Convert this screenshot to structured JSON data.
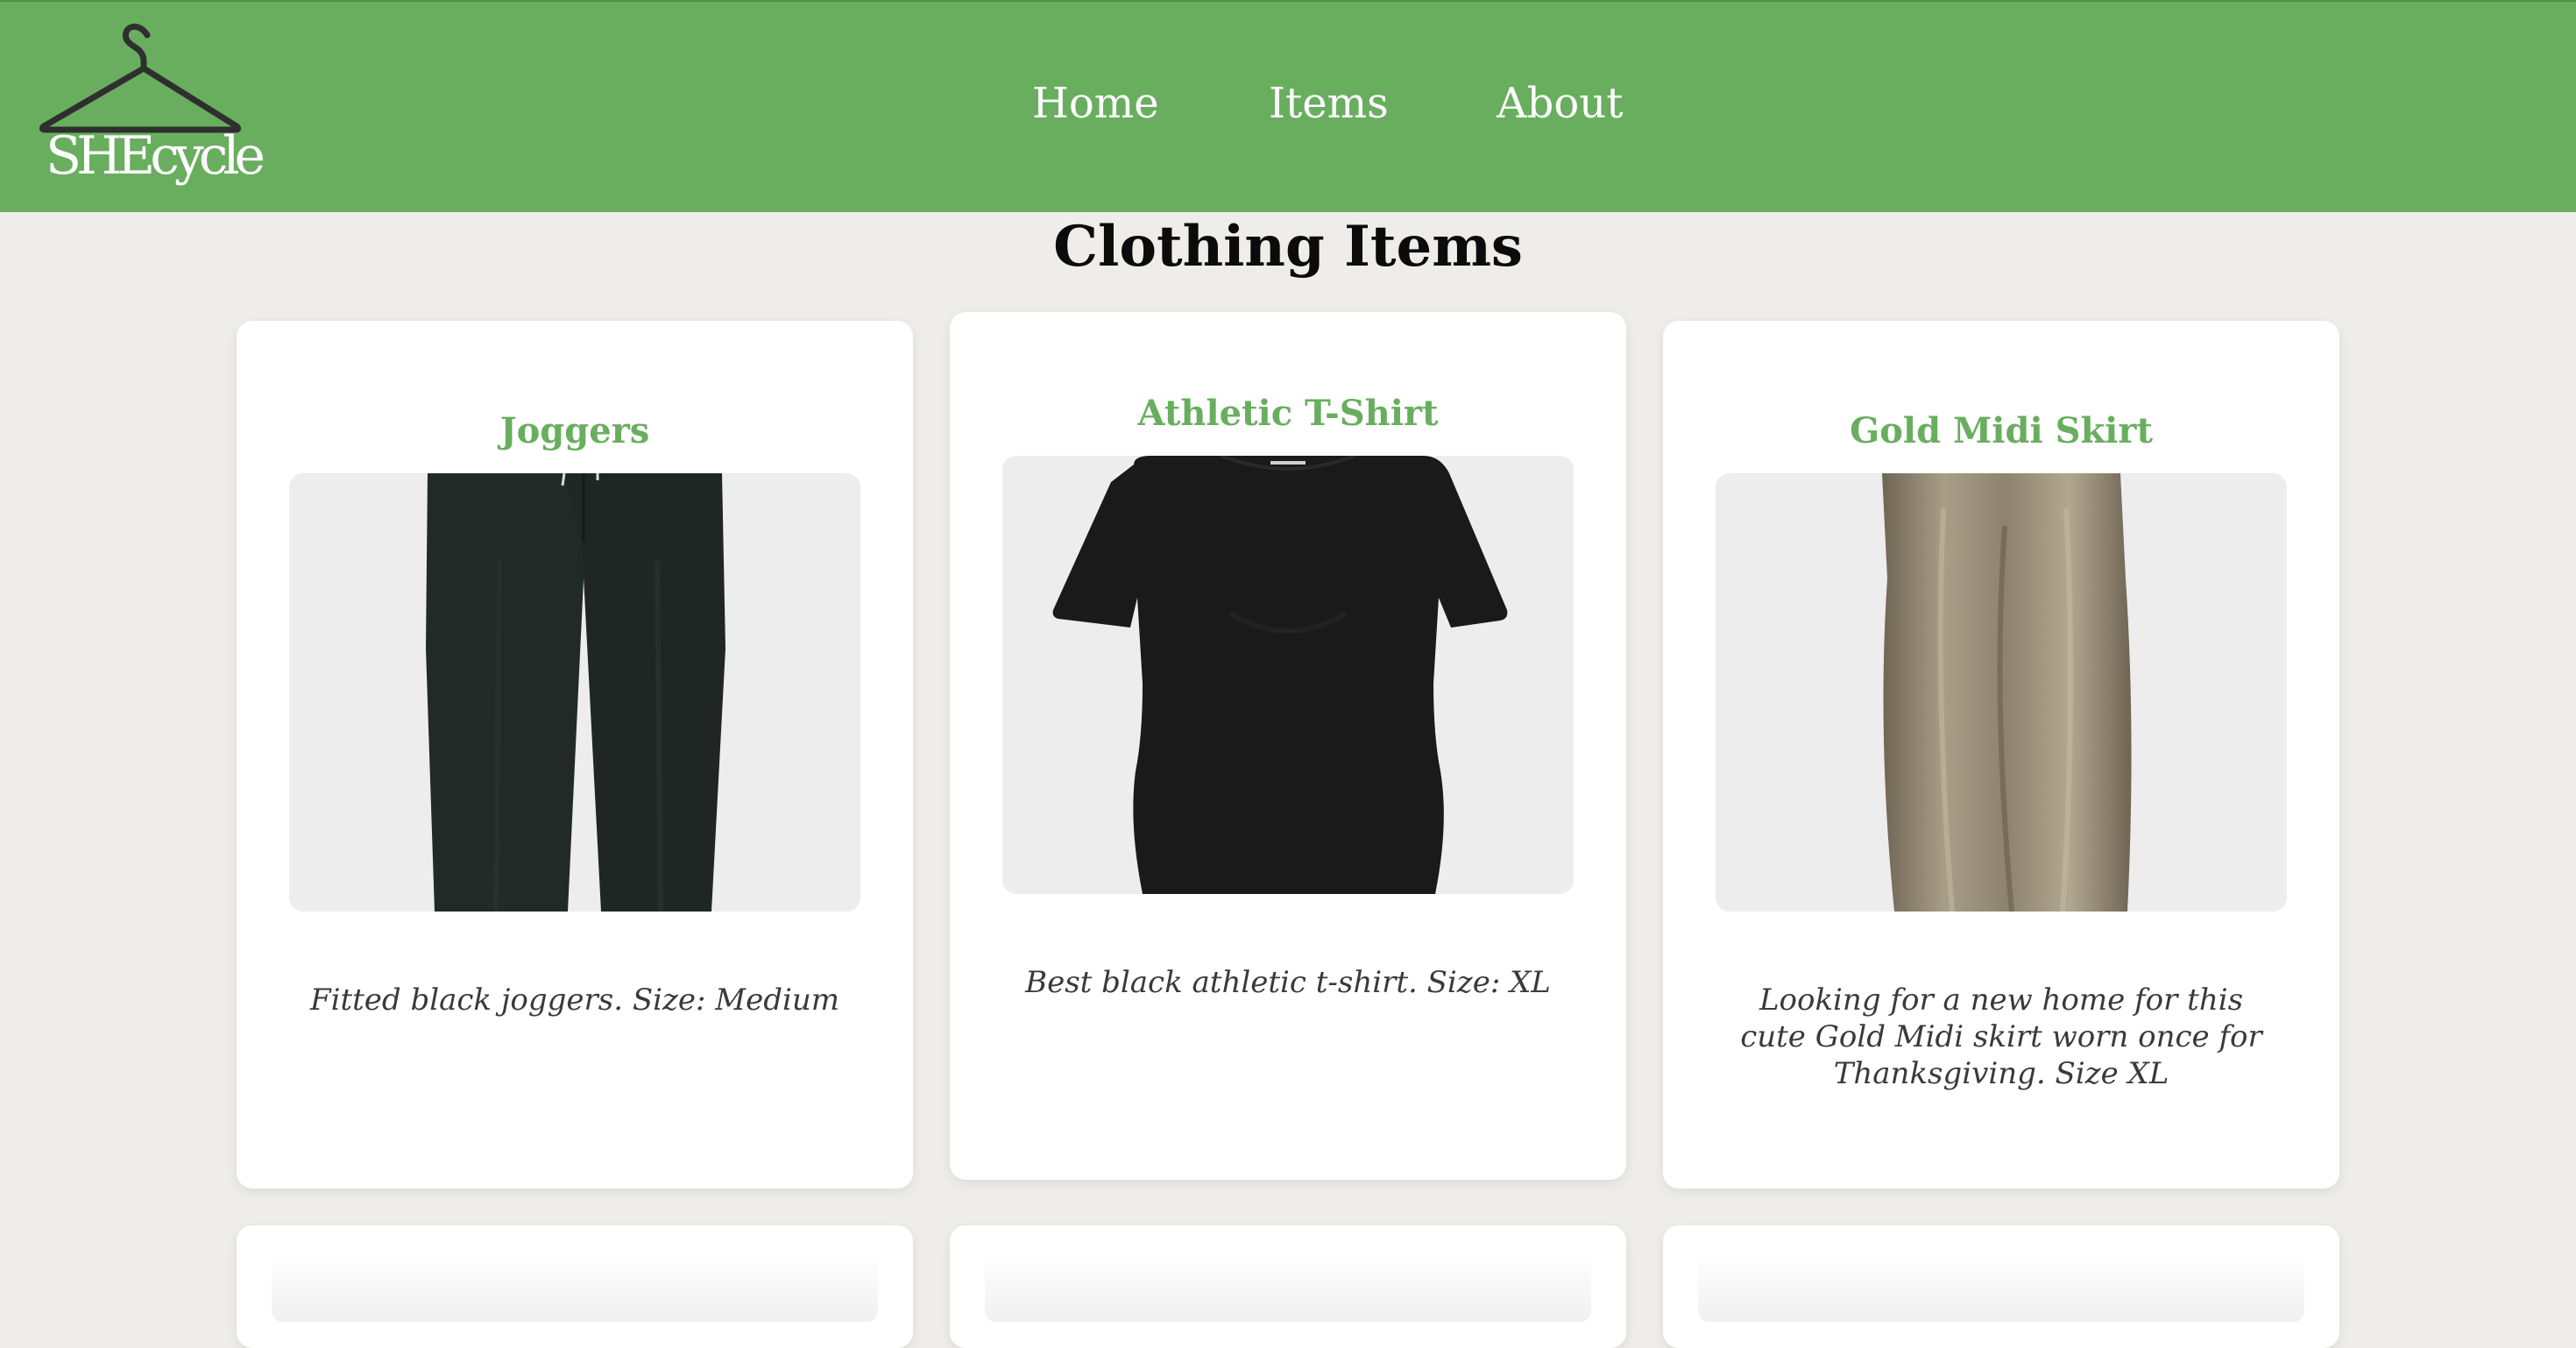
{
  "brand": {
    "logo_text": "SHEcycle",
    "logo_icon": "hanger-icon"
  },
  "nav": {
    "items": [
      {
        "label": "Home"
      },
      {
        "label": "Items"
      },
      {
        "label": "About"
      }
    ]
  },
  "page": {
    "title": "Clothing Items"
  },
  "items": [
    {
      "title": "Joggers",
      "image_icon": "joggers-image",
      "description": "Fitted black joggers. Size: Medium"
    },
    {
      "title": "Athletic T-Shirt",
      "image_icon": "tshirt-image",
      "description": "Best black athletic t-shirt. Size: XL"
    },
    {
      "title": "Gold Midi Skirt",
      "image_icon": "skirt-image",
      "description": "Looking for a new home for this cute Gold Midi skirt worn once for Thanksgiving. Size XL"
    }
  ],
  "colors": {
    "header_bg": "#69ae5f",
    "accent": "#69ae5f",
    "page_bg": "#eeede9",
    "card_bg": "#ffffff"
  }
}
